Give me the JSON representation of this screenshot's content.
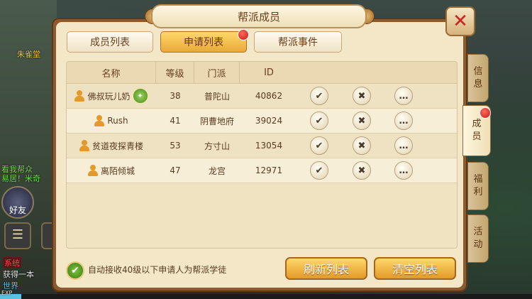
{
  "window": {
    "title": "帮派成员"
  },
  "tabs": [
    {
      "label": "成员列表"
    },
    {
      "label": "申请列表"
    },
    {
      "label": "帮派事件"
    }
  ],
  "table": {
    "headers": [
      "名称",
      "等级",
      "门派",
      "ID"
    ],
    "rows": [
      {
        "name": "佛叔玩儿奶",
        "level": "38",
        "sect": "普陀山",
        "id": "40862"
      },
      {
        "name": "Rush",
        "level": "41",
        "sect": "阴曹地府",
        "id": "39024"
      },
      {
        "name": "贫道夜探青楼",
        "level": "53",
        "sect": "方寸山",
        "id": "13054"
      },
      {
        "name": "离陌倾城",
        "level": "47",
        "sect": "龙宫",
        "id": "12971"
      }
    ]
  },
  "auto_accept_label": "自动接收40级以下申请人为帮派学徒",
  "buttons": {
    "refresh": "刷新列表",
    "clear": "清空列表"
  },
  "side_tabs": [
    {
      "label": "信\n息"
    },
    {
      "label": "成\n员"
    },
    {
      "label": "福\n利"
    },
    {
      "label": "活\n动"
    }
  ],
  "left_hud": {
    "name_tag": "朱雀堂",
    "guild_line1": "看我帮众",
    "guild_line2": "易居！米奇",
    "friend_label": "好友",
    "system_tag": "系统",
    "system_msg": "获得一本",
    "world_tag": "世界",
    "exp_label": "EXP"
  },
  "colors": {
    "accent": "#e9a93a",
    "alert": "#c81818",
    "check": "#4a8a20"
  }
}
